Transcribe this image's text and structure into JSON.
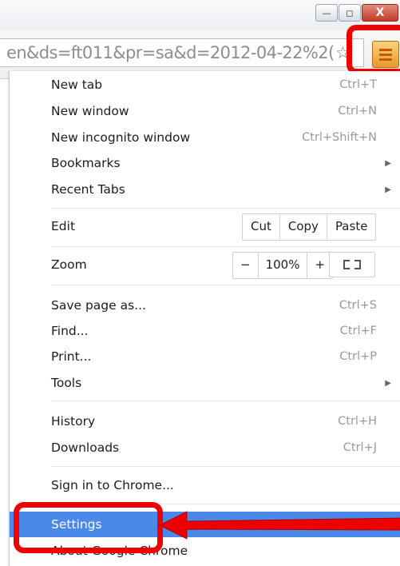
{
  "omnibox": {
    "url_text": "en&ds=ft011&pr=sa&d=2012-04-22%2("
  },
  "window_controls": {
    "minimize": "—",
    "maximize": "◻",
    "close": "X"
  },
  "menu": {
    "items_top": [
      {
        "label": "New tab",
        "shortcut": "Ctrl+T"
      },
      {
        "label": "New window",
        "shortcut": "Ctrl+N"
      },
      {
        "label": "New incognito window",
        "shortcut": "Ctrl+Shift+N"
      },
      {
        "label": "Bookmarks",
        "shortcut": "",
        "submenu": true
      },
      {
        "label": "Recent Tabs",
        "shortcut": "",
        "submenu": true
      }
    ],
    "edit": {
      "label": "Edit",
      "cut": "Cut",
      "copy": "Copy",
      "paste": "Paste"
    },
    "zoom": {
      "label": "Zoom",
      "minus": "−",
      "level": "100%",
      "plus": "+"
    },
    "items_mid": [
      {
        "label": "Save page as...",
        "shortcut": "Ctrl+S"
      },
      {
        "label": "Find...",
        "shortcut": "Ctrl+F"
      },
      {
        "label": "Print...",
        "shortcut": "Ctrl+P"
      },
      {
        "label": "Tools",
        "shortcut": "",
        "submenu": true
      }
    ],
    "items_history": [
      {
        "label": "History",
        "shortcut": "Ctrl+H"
      },
      {
        "label": "Downloads",
        "shortcut": "Ctrl+J"
      }
    ],
    "sign_in": {
      "label": "Sign in to Chrome..."
    },
    "settings": {
      "label": "Settings"
    },
    "about": {
      "label": "About Google Chrome"
    }
  },
  "colors": {
    "highlight": "#4a89e8",
    "annotation": "#ee0000",
    "menu_button": "#f0a830"
  }
}
